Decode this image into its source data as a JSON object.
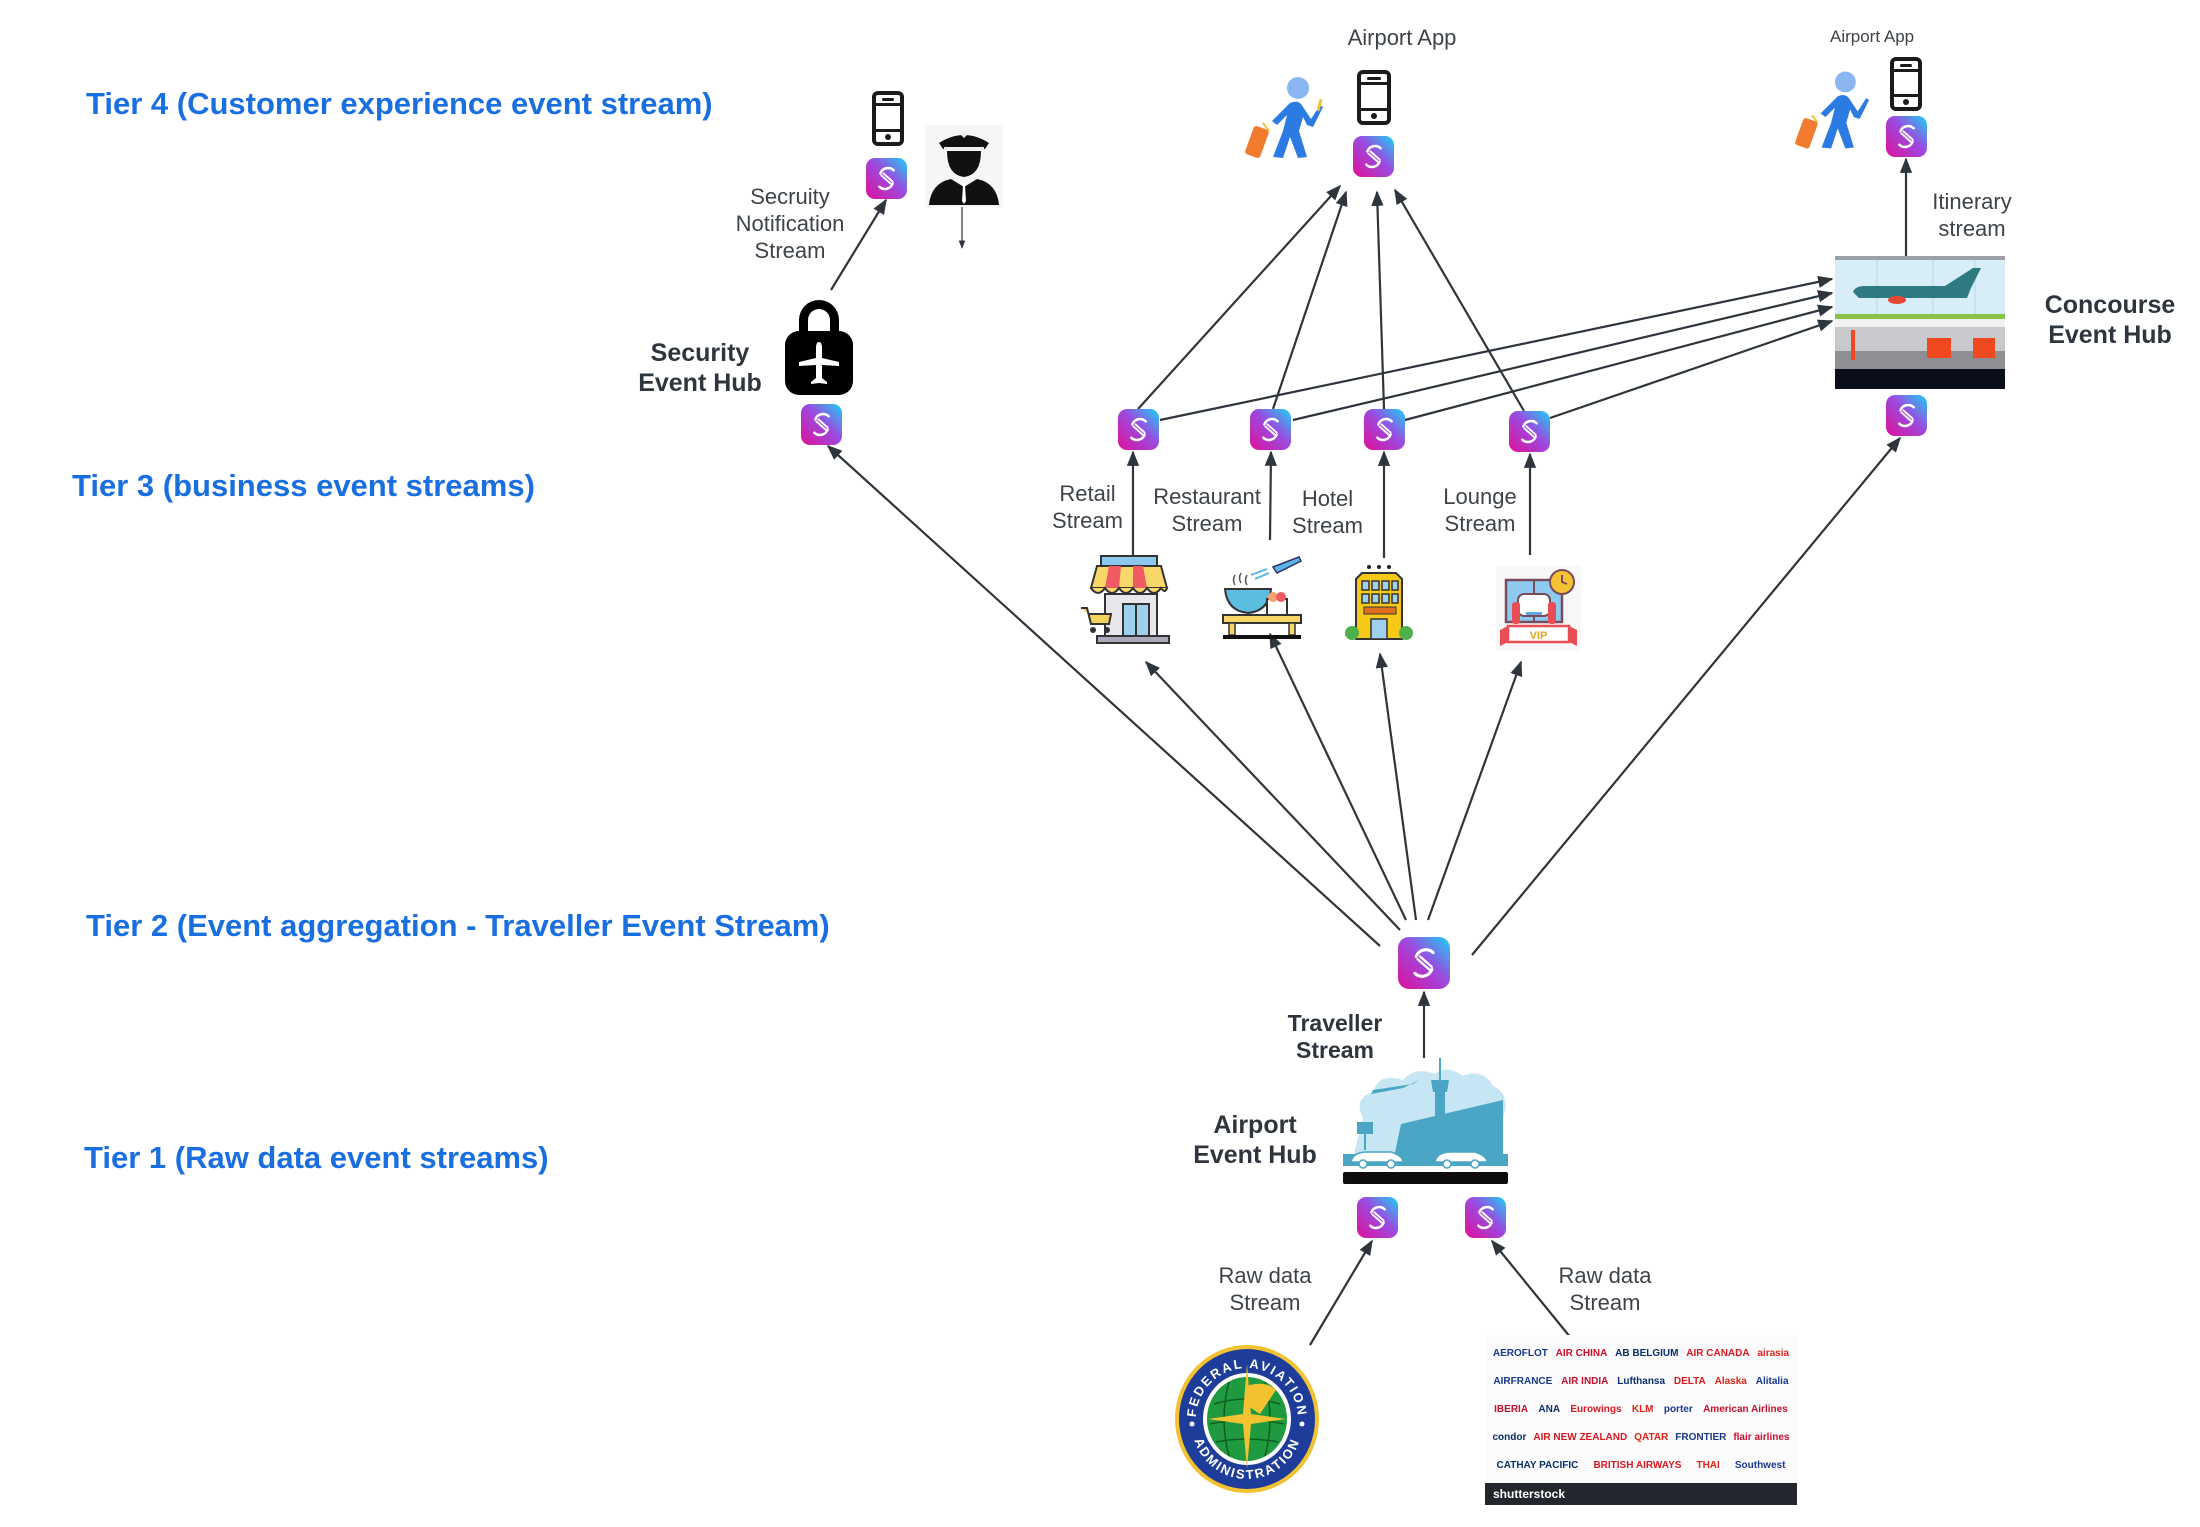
{
  "tiers": [
    {
      "id": "tier4",
      "label": "Tier 4 (Customer experience event stream)"
    },
    {
      "id": "tier3",
      "label": "Tier 3 (business event streams)"
    },
    {
      "id": "tier2",
      "label": "Tier 2 (Event aggregation - Traveller Event Stream)"
    },
    {
      "id": "tier1",
      "label": "Tier 1 (Raw  data event streams)"
    }
  ],
  "colors": {
    "tier_label": "#1a6fe0",
    "arrow": "#2f353d",
    "stream_gradient": [
      "#e0109a",
      "#9a4be0",
      "#19d3f5"
    ]
  },
  "tier4": {
    "airport_app_main": {
      "title": "Airport App"
    },
    "airport_app_right": {
      "title": "Airport App"
    },
    "security_notification": {
      "label_lines": [
        "Secruity",
        "Notification",
        "Stream"
      ]
    }
  },
  "hubs": {
    "security": {
      "label_lines": [
        "Security",
        "Event Hub"
      ]
    },
    "concourse": {
      "label_lines": [
        "Concourse",
        "Event Hub"
      ]
    },
    "airport": {
      "label_lines": [
        "Airport",
        "Event Hub"
      ]
    }
  },
  "itinerary": {
    "label_lines": [
      "Itinerary",
      "stream"
    ]
  },
  "business_streams": [
    {
      "id": "retail",
      "label_lines": [
        "Retail",
        "Stream"
      ],
      "icon": "shop-icon"
    },
    {
      "id": "restaurant",
      "label_lines": [
        "Restaurant",
        "Stream"
      ],
      "icon": "restaurant-icon"
    },
    {
      "id": "hotel",
      "label_lines": [
        "Hotel",
        "Stream"
      ],
      "icon": "hotel-icon"
    },
    {
      "id": "lounge",
      "label_lines": [
        "Lounge",
        "Stream"
      ],
      "icon": "vip-lounge-icon",
      "badge": "VIP"
    }
  ],
  "traveller_stream": {
    "label_lines": [
      "Traveller",
      "Stream"
    ]
  },
  "raw_streams": [
    {
      "id": "faa",
      "label_lines": [
        "Raw data",
        "Stream"
      ]
    },
    {
      "id": "airlines",
      "label_lines": [
        "Raw data",
        "Stream"
      ]
    }
  ],
  "faa_seal": {
    "top_text": "FEDERAL AVIATION",
    "bottom_text": "ADMINISTRATION"
  },
  "airlines_panel": {
    "logos": [
      "AEROFLOT",
      "AIR CHINA",
      "AB BELGIUM",
      "AIR CANADA",
      "airasia",
      "AIRFRANCE",
      "AIR INDIA",
      "Lufthansa",
      "DELTA",
      "Alaska",
      "Alitalia",
      "IBERIA",
      "ANA",
      "Eurowings",
      "KLM",
      "porter",
      "American Airlines",
      "condor",
      "AIR NEW ZEALAND",
      "QATAR",
      "FRONTIER",
      "flair airlines",
      "CATHAY PACIFIC",
      "BRITISH AIRWAYS",
      "THAI",
      "Southwest"
    ],
    "footer": "shutterstock"
  },
  "arrows": [
    {
      "from": "traveller",
      "to": "security-hub-stream"
    },
    {
      "from": "traveller",
      "to": "retail"
    },
    {
      "from": "traveller",
      "to": "restaurant"
    },
    {
      "from": "traveller",
      "to": "hotel"
    },
    {
      "from": "traveller",
      "to": "lounge"
    },
    {
      "from": "traveller",
      "to": "concourse-stream"
    },
    {
      "from": "airport-hub",
      "to": "traveller"
    },
    {
      "from": "faa",
      "to": "raw-stream-left"
    },
    {
      "from": "airlines",
      "to": "raw-stream-right"
    },
    {
      "from": "retail-stream",
      "to": "airport-app-main"
    },
    {
      "from": "restaurant-stream",
      "to": "airport-app-main"
    },
    {
      "from": "hotel-stream",
      "to": "airport-app-main"
    },
    {
      "from": "lounge-stream",
      "to": "airport-app-main"
    },
    {
      "from": "retail-stream",
      "to": "concourse-hub"
    },
    {
      "from": "restaurant-stream",
      "to": "concourse-hub"
    },
    {
      "from": "hotel-stream",
      "to": "concourse-hub"
    },
    {
      "from": "lounge-stream",
      "to": "concourse-hub"
    },
    {
      "from": "concourse-hub",
      "to": "airport-app-right"
    },
    {
      "from": "security-hub",
      "to": "security-notification-stream"
    },
    {
      "from": "officer",
      "to": "below"
    },
    {
      "from": "retail",
      "to": "retail-stream"
    },
    {
      "from": "restaurant",
      "to": "restaurant-stream"
    },
    {
      "from": "hotel",
      "to": "hotel-stream"
    },
    {
      "from": "lounge",
      "to": "lounge-stream"
    }
  ]
}
